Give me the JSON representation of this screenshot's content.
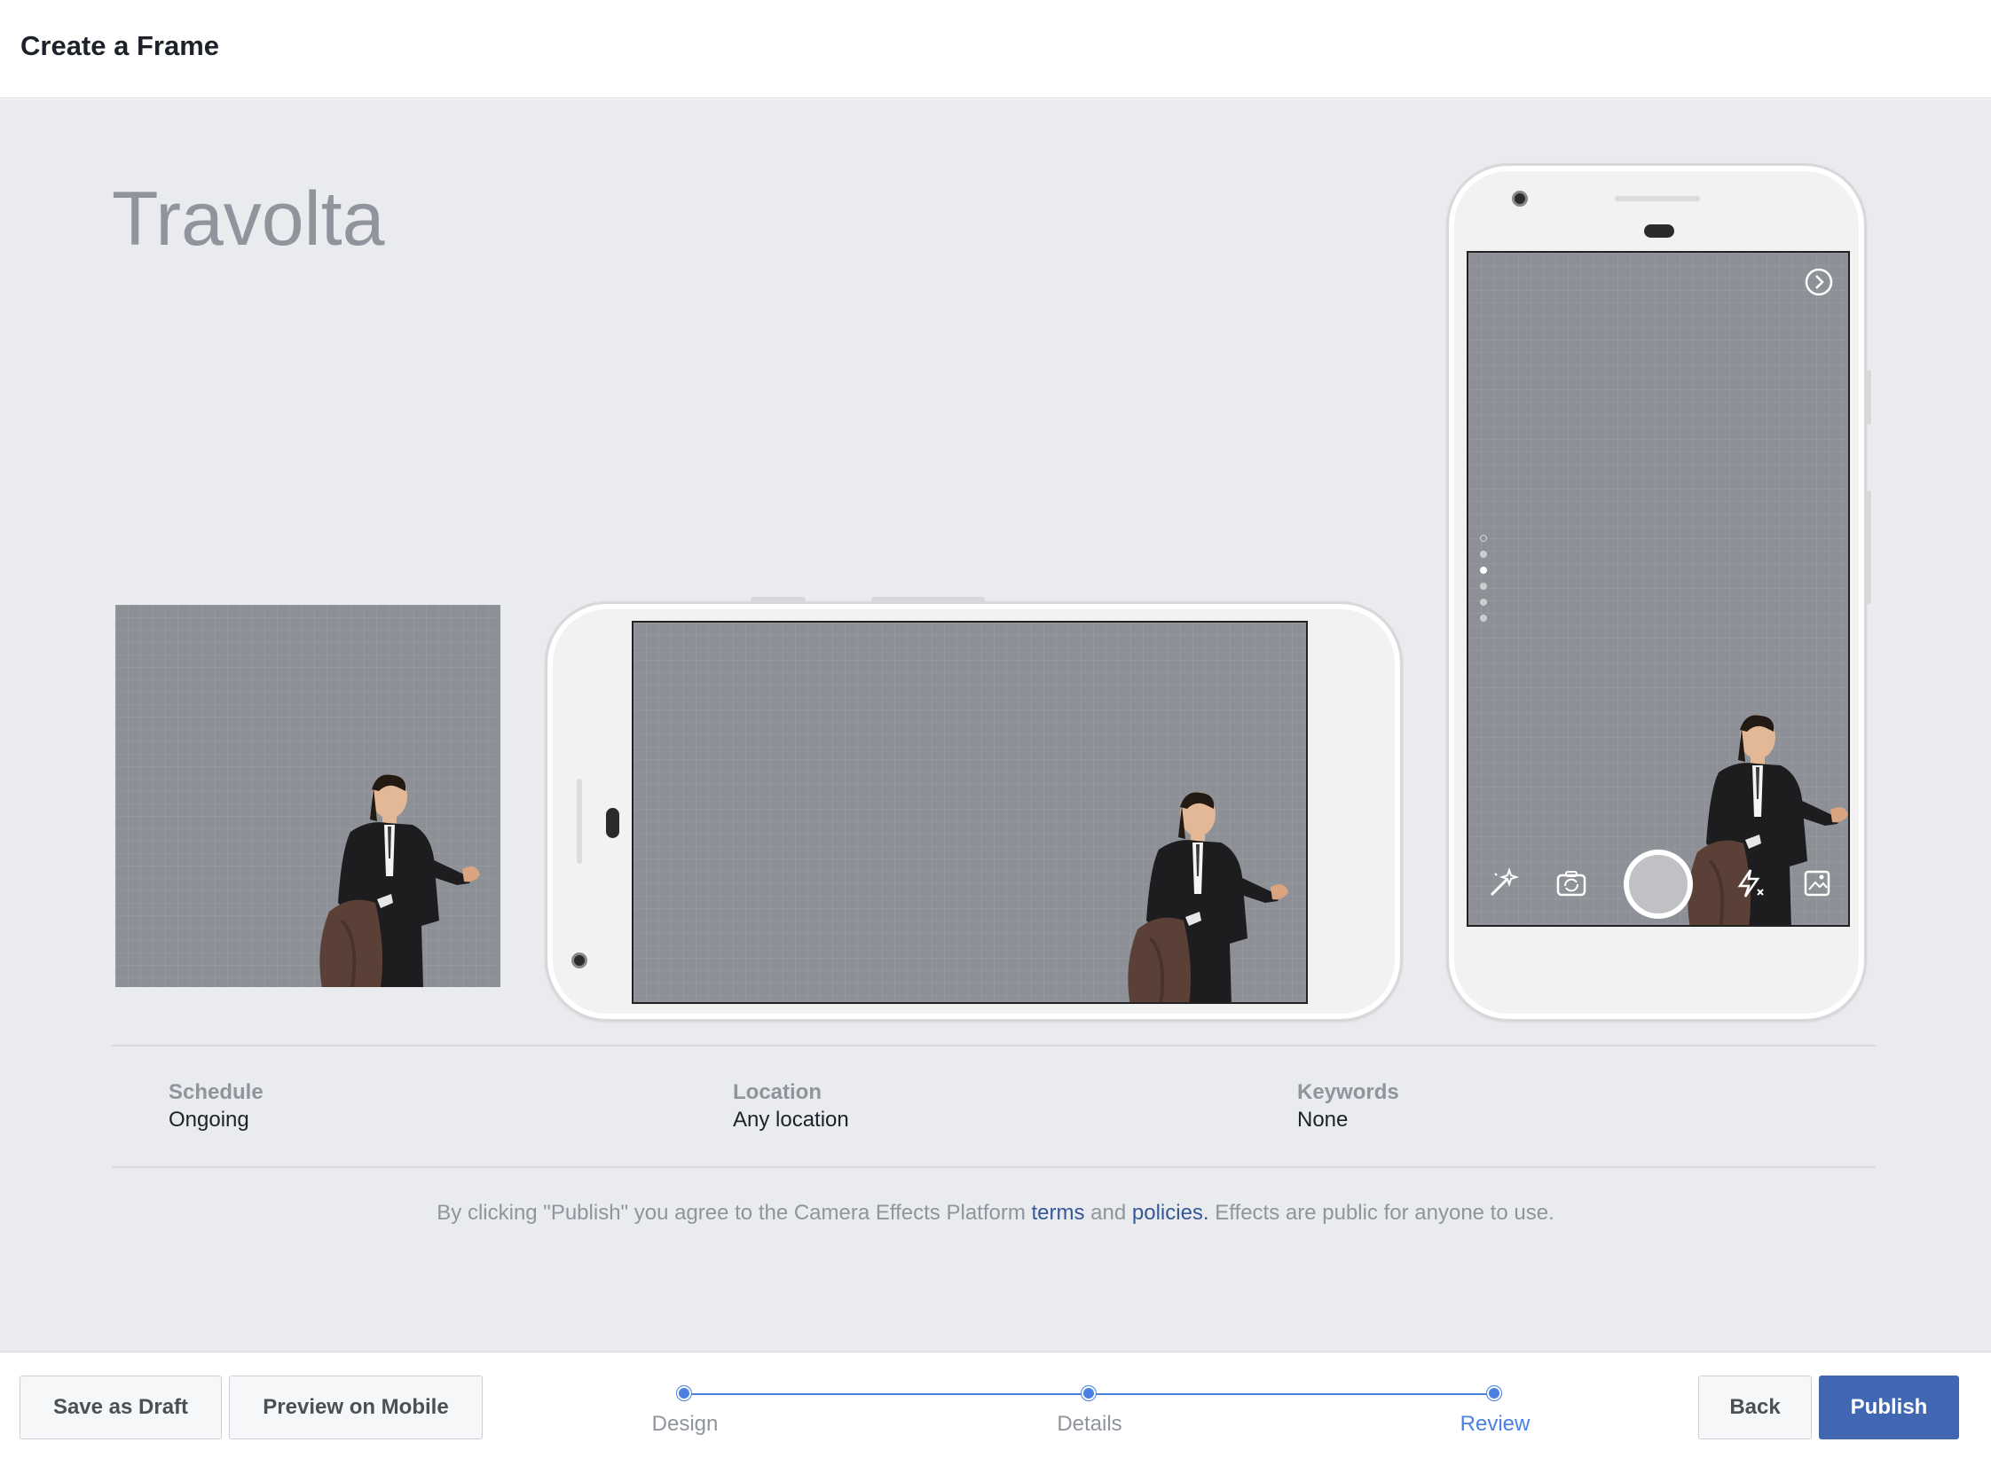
{
  "header": {
    "title": "Create a Frame"
  },
  "frame": {
    "name": "Travolta"
  },
  "details": {
    "schedule": {
      "label": "Schedule",
      "value": "Ongoing"
    },
    "location": {
      "label": "Location",
      "value": "Any location"
    },
    "keywords": {
      "label": "Keywords",
      "value": "None"
    }
  },
  "terms": {
    "prefix": "By clicking \"Publish\" you agree to the Camera Effects Platform ",
    "terms_link": "terms",
    "middle": " and ",
    "policies_link": "policies.",
    "suffix": " Effects are public for anyone to use."
  },
  "footer": {
    "save_draft": "Save as Draft",
    "preview_mobile": "Preview on Mobile",
    "back": "Back",
    "publish": "Publish"
  },
  "steps": [
    {
      "label": "Design",
      "active": false
    },
    {
      "label": "Details",
      "active": false
    },
    {
      "label": "Review",
      "active": true
    }
  ],
  "camera": {
    "icons": [
      "magic-wand-icon",
      "switch-camera-icon",
      "shutter-button",
      "flash-off-icon",
      "gallery-icon"
    ],
    "next_icon": "chevron-right-circle-icon"
  },
  "colors": {
    "accent": "#4267b2",
    "step_blue": "#4a80e0",
    "link": "#365899",
    "canvas_bg": "#8d9096"
  }
}
